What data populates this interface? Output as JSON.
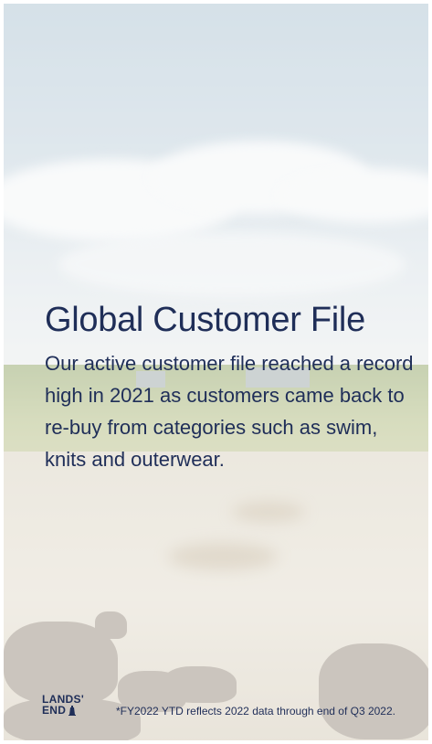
{
  "slide": {
    "title": "Global Customer File",
    "body": "Our active customer file reached a record high in 2021 as customers came back to re-buy from categories such as swim, knits and outerwear.",
    "footnote": "*FY2022 YTD reflects 2022 data through end of Q3 2022."
  },
  "logo": {
    "line1": "LANDS'",
    "line2": "END"
  },
  "colors": {
    "text": "#1f2e58",
    "sky": "#c7d6e0",
    "sand": "#e6e0d3"
  }
}
